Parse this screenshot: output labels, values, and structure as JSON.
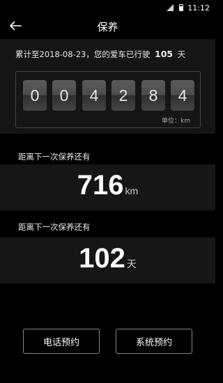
{
  "status_bar": {
    "time": "11:12",
    "signal_icon": "signal-icon",
    "battery_icon": "battery-icon"
  },
  "app_bar": {
    "title": "保养",
    "back_icon": "back-arrow-icon"
  },
  "summary": {
    "prefix": "累计至2018-08-23，您的爱车已行驶",
    "days": "105",
    "suffix": "天"
  },
  "odometer": {
    "digits": [
      "0",
      "0",
      "4",
      "2",
      "8",
      "4"
    ],
    "unit": "单位：km"
  },
  "next_distance": {
    "label": "距离下一次保养还有",
    "value": "716",
    "unit": "km"
  },
  "next_days": {
    "label": "距离下一次保养还有",
    "value": "102",
    "unit": "天"
  },
  "buttons": {
    "phone": "电话预约",
    "system": "系统预约"
  }
}
